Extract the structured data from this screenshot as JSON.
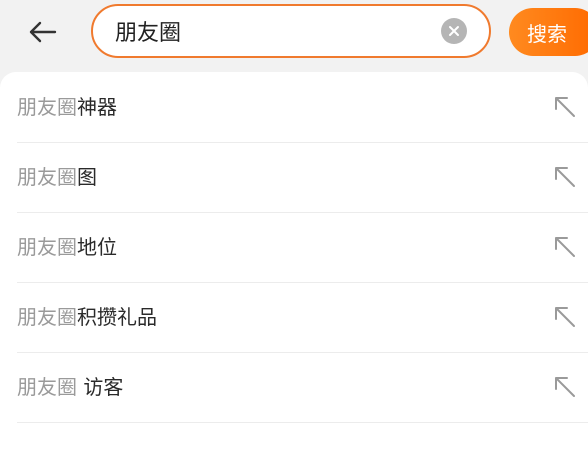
{
  "header": {
    "back_icon": "arrow-left-icon",
    "search": {
      "value": "朋友圈",
      "clear_icon": "clear-circle-icon"
    },
    "search_button_label": "搜索",
    "accent_color": "#f07a2e"
  },
  "suggestions": [
    {
      "keyword": "朋友圈",
      "rest": "神器",
      "icon": "arrow-up-left-icon"
    },
    {
      "keyword": "朋友圈",
      "rest": "图",
      "icon": "arrow-up-left-icon"
    },
    {
      "keyword": "朋友圈",
      "rest": "地位",
      "icon": "arrow-up-left-icon"
    },
    {
      "keyword": "朋友圈",
      "rest": "积攒礼品",
      "icon": "arrow-up-left-icon"
    },
    {
      "keyword": "朋友圈",
      "rest": " 访客",
      "icon": "arrow-up-left-icon"
    }
  ]
}
